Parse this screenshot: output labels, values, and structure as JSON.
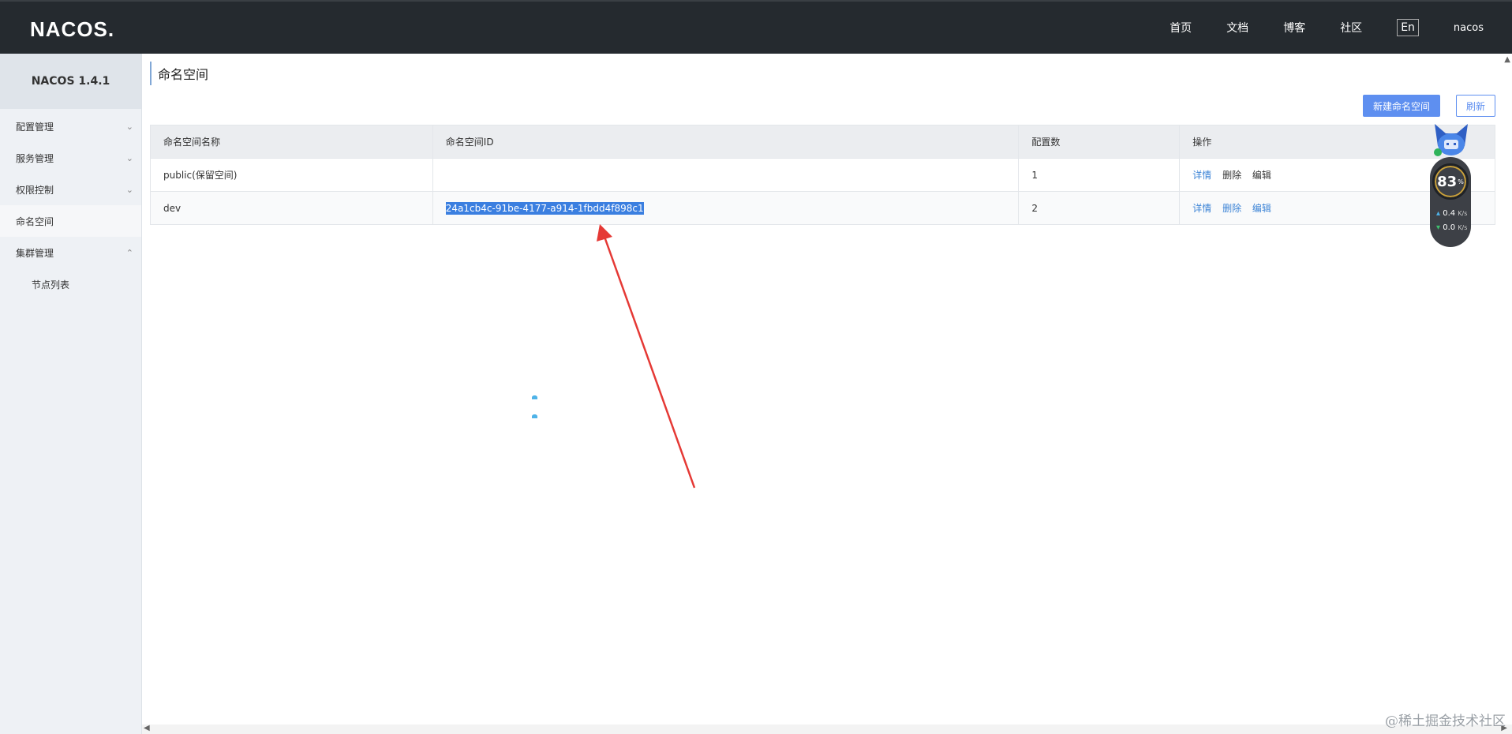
{
  "header": {
    "logo": "NACOS.",
    "nav": [
      "首页",
      "文档",
      "博客",
      "社区"
    ],
    "lang": "En",
    "user": "nacos"
  },
  "sidebar": {
    "version": "NACOS 1.4.1",
    "items": [
      {
        "label": "配置管理",
        "chevron": "chevron-down"
      },
      {
        "label": "服务管理",
        "chevron": "chevron-down"
      },
      {
        "label": "权限控制",
        "chevron": "chevron-down"
      },
      {
        "label": "命名空间",
        "chevron": ""
      },
      {
        "label": "集群管理",
        "chevron": "chevron-up"
      }
    ],
    "subitems": [
      "节点列表"
    ]
  },
  "main": {
    "title": "命名空间",
    "new_button": "新建命名空间",
    "refresh_button": "刷新",
    "table": {
      "headers": [
        "命名空间名称",
        "命名空间ID",
        "配置数",
        "操作"
      ],
      "rows": [
        {
          "name": "public(保留空间)",
          "id": "",
          "count": "1",
          "ops": [
            "详情",
            "删除",
            "编辑"
          ]
        },
        {
          "name": "dev",
          "id": "24a1cb4c-91be-4177-a914-1fbdd4f898c1",
          "count": "2",
          "ops": [
            "详情",
            "删除",
            "编辑"
          ]
        }
      ]
    }
  },
  "widget": {
    "percent": "83",
    "percent_unit": "%",
    "up_speed": "0.4",
    "down_speed": "0.0",
    "speed_unit": "K/s"
  },
  "watermark": "@稀土掘金技术社区",
  "colors": {
    "topbar": "#252a2f",
    "primary": "#5e8ff0",
    "link": "#3d84d6",
    "annotation_arrow": "#e53935"
  }
}
